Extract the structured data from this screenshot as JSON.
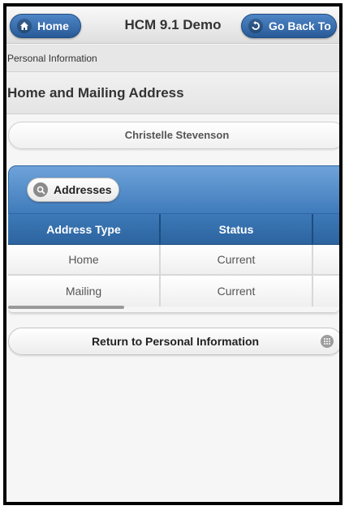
{
  "header": {
    "home_label": "Home",
    "title": "HCM 9.1 Demo",
    "back_label": "Go Back To"
  },
  "breadcrumb": "Personal Information",
  "page_title": "Home and Mailing Address",
  "employee_name": "Christelle Stevenson",
  "addresses": {
    "button_label": "Addresses",
    "columns": [
      "Address Type",
      "Status",
      ""
    ],
    "rows": [
      {
        "type": "Home",
        "status": "Current"
      },
      {
        "type": "Mailing",
        "status": "Current"
      }
    ]
  },
  "return_label": "Return to Personal Information",
  "colors": {
    "accent_blue": "#3d79b8",
    "header_blue": "#2c649f",
    "background": "#f6f6f6"
  },
  "icons": {
    "home": "home-icon",
    "back": "back-arrow-icon",
    "search": "search-icon",
    "grid": "grid-icon"
  }
}
